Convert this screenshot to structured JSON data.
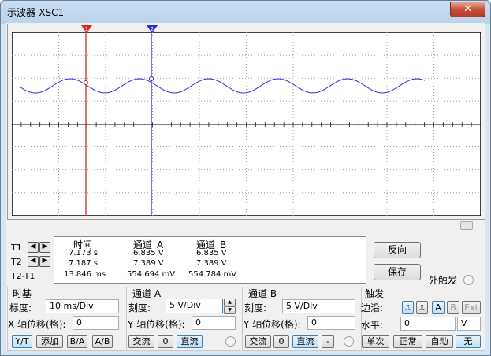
{
  "window": {
    "title": "示波器-XSC1",
    "close": "✕"
  },
  "readout": {
    "headers": {
      "time": "时间",
      "cha": "通道_A",
      "chb": "通道_B"
    },
    "rows": [
      {
        "label": "T1",
        "time": "7.173 s",
        "cha": "6.835 V",
        "chb": "6.835 V"
      },
      {
        "label": "T2",
        "time": "7.187 s",
        "cha": "7.389 V",
        "chb": "7.389 V"
      },
      {
        "label": "T2-T1",
        "time": "13.846 ms",
        "cha": "554.694 mV",
        "chb": "554.784 mV"
      }
    ]
  },
  "buttons": {
    "reverse": "反向",
    "save": "保存"
  },
  "ext_trigger": "外触发",
  "timebase": {
    "title": "时基",
    "scale_label": "标度:",
    "scale_value": "10 ms/Div",
    "xpos_label": "X 轴位移(格):",
    "xpos_value": "0",
    "modes": [
      "Y/T",
      "添加",
      "B/A",
      "A/B"
    ],
    "active_mode": "Y/T"
  },
  "channel_a": {
    "title": "通道 A",
    "scale_label": "刻度:",
    "scale_value": "5  V/Div",
    "ypos_label": "Y 轴位移(格):",
    "ypos_value": "0",
    "coupling": [
      "交流",
      "0",
      "直流"
    ],
    "active_coupling": "直流"
  },
  "channel_b": {
    "title": "通道 B",
    "scale_label": "刻度:",
    "scale_value": "5  V/Div",
    "ypos_label": "Y 轴位移(格):",
    "ypos_value": "0",
    "coupling": [
      "交流",
      "0",
      "直流",
      "-"
    ],
    "active_coupling": "直流"
  },
  "trigger": {
    "title": "触发",
    "edge_label": "边沿:",
    "edge_buttons": [
      "A",
      "B",
      "Ext"
    ],
    "level_label": "水平:",
    "level_value": "0",
    "level_unit": "V",
    "modes": [
      "单次",
      "正常",
      "自动",
      "无"
    ],
    "active_mode": "无"
  },
  "cursors": {
    "t1": "1",
    "t2": "2"
  },
  "colors": {
    "cursor1": "#d42a2a",
    "cursor2": "#2a2ad4",
    "trace": "#2a2ad4",
    "grid": "#9a9a9a"
  }
}
